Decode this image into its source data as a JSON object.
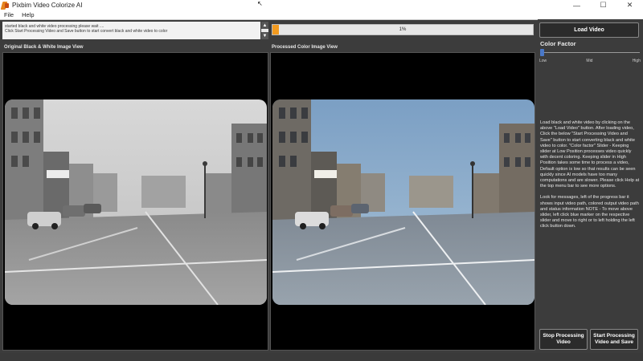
{
  "window": {
    "title": "Pixbim Video Colorize AI",
    "minimize": "—",
    "maximize": "☐",
    "close": "✕"
  },
  "menu": {
    "file": "File",
    "help": "Help"
  },
  "messages": {
    "line1": "started black and white video processing please wait ....",
    "line2": "Click Start Processing Video and Save button to start convert black and white video to color"
  },
  "progress": {
    "value": 0.01,
    "label": "1%"
  },
  "panels": {
    "left_label": "Original Black & White  Image View",
    "right_label": "Processed Color Image View"
  },
  "sidebar": {
    "load_button": "Load Video",
    "color_factor_title": "Color Factor",
    "slider": {
      "value": 0,
      "low": "Low",
      "mid": "Mid",
      "high": "High"
    },
    "info_p1": "Load black and white video by clicking on the above \"Load Video\" button. After loading video, Click the below \"Start Processing Video and Save\" button to start converting black and white video to color. \"Color factor\" Slider - Keeping slider at Low Position processes video quickly with decent coloring. Keeping slider in High Position takes some time to process a video, Default option is low so that results can be seen quickly since AI models have too many computations and are slower. Please click Help at the top menu bar to see more options.",
    "info_p2": "Look for messages, left of the progress bar it shows input video path, colored output video path and status information NOTE - To move above slider, left click blue marker on the respective slider and move to right or to left holding the left click button down.",
    "stop_button": "Stop Processing Video",
    "start_button": "Start Processing Video and Save"
  },
  "colors": {
    "accent_progress": "#f29a1f",
    "slider_thumb": "#4a78c8",
    "button_bg": "#2b2b2b"
  }
}
